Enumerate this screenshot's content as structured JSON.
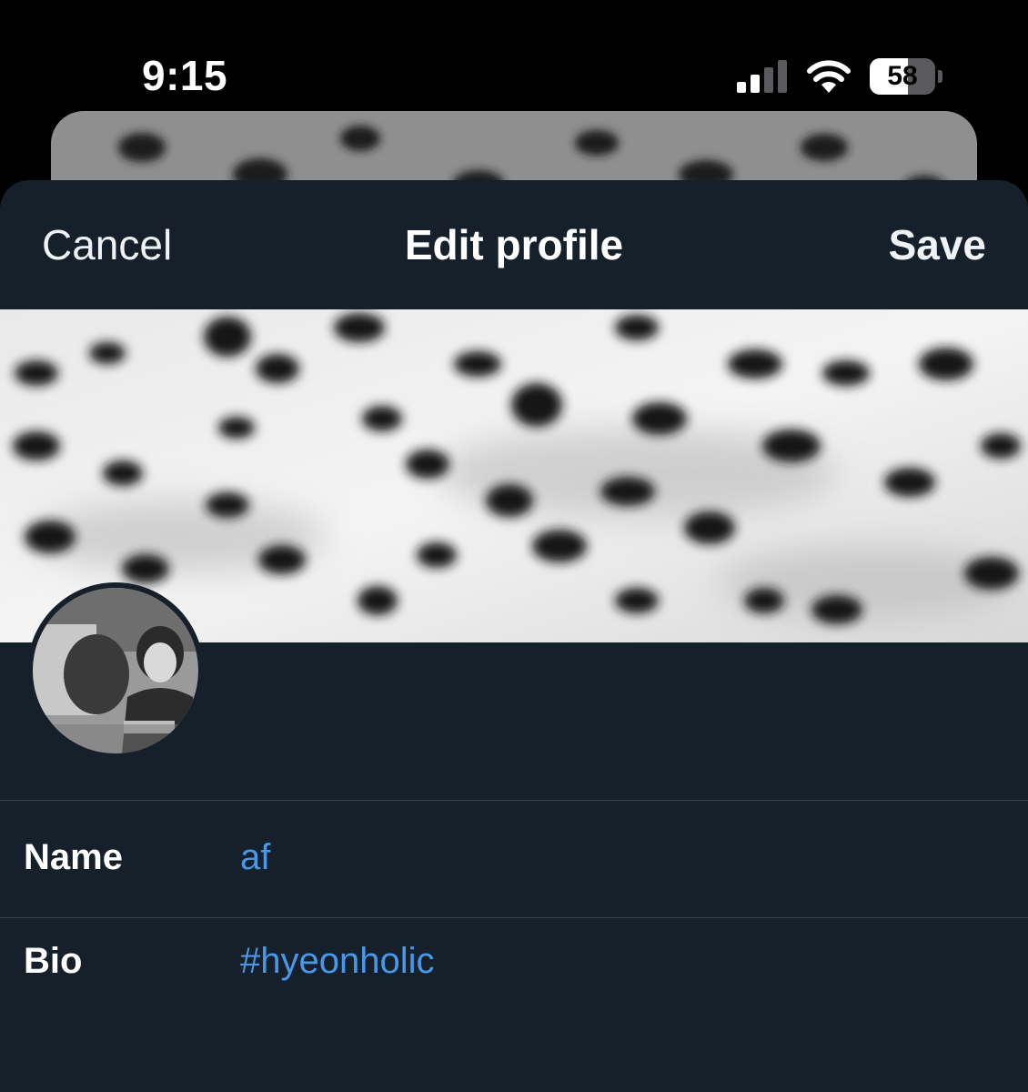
{
  "status_bar": {
    "time": "9:15",
    "signal_icon": "cellular-signal-icon",
    "signal_bars_active": 2,
    "signal_bars_total": 4,
    "wifi_icon": "wifi-icon",
    "battery_icon": "battery-icon",
    "battery_level": "58",
    "battery_fraction": 0.58
  },
  "nav": {
    "cancel_label": "Cancel",
    "title": "Edit profile",
    "save_label": "Save"
  },
  "profile": {
    "header_image": "snow leopard fur header photo",
    "avatar_image": "black and white profile photo"
  },
  "fields": {
    "name": {
      "label": "Name",
      "value": "af"
    },
    "bio": {
      "label": "Bio",
      "value": "#hyeonholic"
    }
  },
  "colors": {
    "sheet_background": "#15202b",
    "link_value": "#4a97e8",
    "divider": "#38444d"
  }
}
